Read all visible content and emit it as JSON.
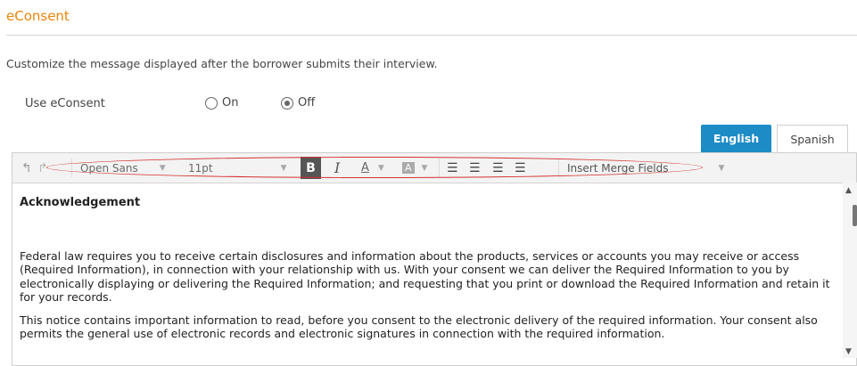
{
  "page": {
    "title": "eConsent",
    "description": "Customize the message displayed after the borrower submits their interview."
  },
  "consent_toggle": {
    "label": "Use eConsent",
    "options": [
      {
        "label": "On",
        "checked": false
      },
      {
        "label": "Off",
        "checked": true
      }
    ]
  },
  "language_tabs": [
    {
      "label": "English",
      "active": true
    },
    {
      "label": "Spanish",
      "active": false
    }
  ],
  "toolbar": {
    "undo_icon": "undo-icon",
    "redo_icon": "redo-icon",
    "font_family": "Open Sans",
    "font_size": "11pt",
    "bold_label": "B",
    "italic_label": "I",
    "font_color_label": "A",
    "background_color_label": "A",
    "align_icons": [
      "align-left-icon",
      "align-center-icon",
      "align-right-icon",
      "align-justify-icon"
    ],
    "merge_fields_label": "Insert Merge Fields"
  },
  "editor_content": {
    "heading": "Acknowledgement",
    "paragraphs": [
      "Federal law requires you to receive certain disclosures and information about the products, services or accounts you may receive or access (Required Information), in connection with your relationship with us. With your consent we can deliver the Required Information to you by electronically displaying or delivering the Required Information; and requesting that you print or download the Required Information and retain it for your records.",
      "This notice contains important information to read, before you consent to the electronic delivery of the required information. Your consent also permits the general use of electronic records and electronic signatures in connection with the required information."
    ]
  },
  "colors": {
    "title_orange": "#e8850c",
    "tab_active_blue": "#1c8bc6",
    "highlight_red": "#d4312f"
  }
}
